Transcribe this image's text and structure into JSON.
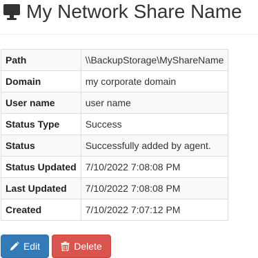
{
  "header": {
    "title": "My Network Share Name",
    "icon": "desktop-icon"
  },
  "details": [
    {
      "key": "path",
      "label": "Path",
      "value": "\\\\BackupStorage\\MyShareName"
    },
    {
      "key": "domain",
      "label": "Domain",
      "value": "my corporate domain"
    },
    {
      "key": "username",
      "label": "User name",
      "value": "user name"
    },
    {
      "key": "status-type",
      "label": "Status Type",
      "value": "Success"
    },
    {
      "key": "status",
      "label": "Status",
      "value": "Successfully added by agent."
    },
    {
      "key": "status-updated",
      "label": "Status Updated",
      "value": "7/10/2022 7:08:08 PM"
    },
    {
      "key": "last-updated",
      "label": "Last Updated",
      "value": "7/10/2022 7:08:08 PM"
    },
    {
      "key": "created",
      "label": "Created",
      "value": "7/10/2022 7:07:12 PM"
    }
  ],
  "actions": {
    "edit_label": "Edit",
    "edit_icon": "pencil-icon",
    "edit_color": "#337ab7",
    "delete_label": "Delete",
    "delete_icon": "trash-icon",
    "delete_color": "#d9534f"
  }
}
